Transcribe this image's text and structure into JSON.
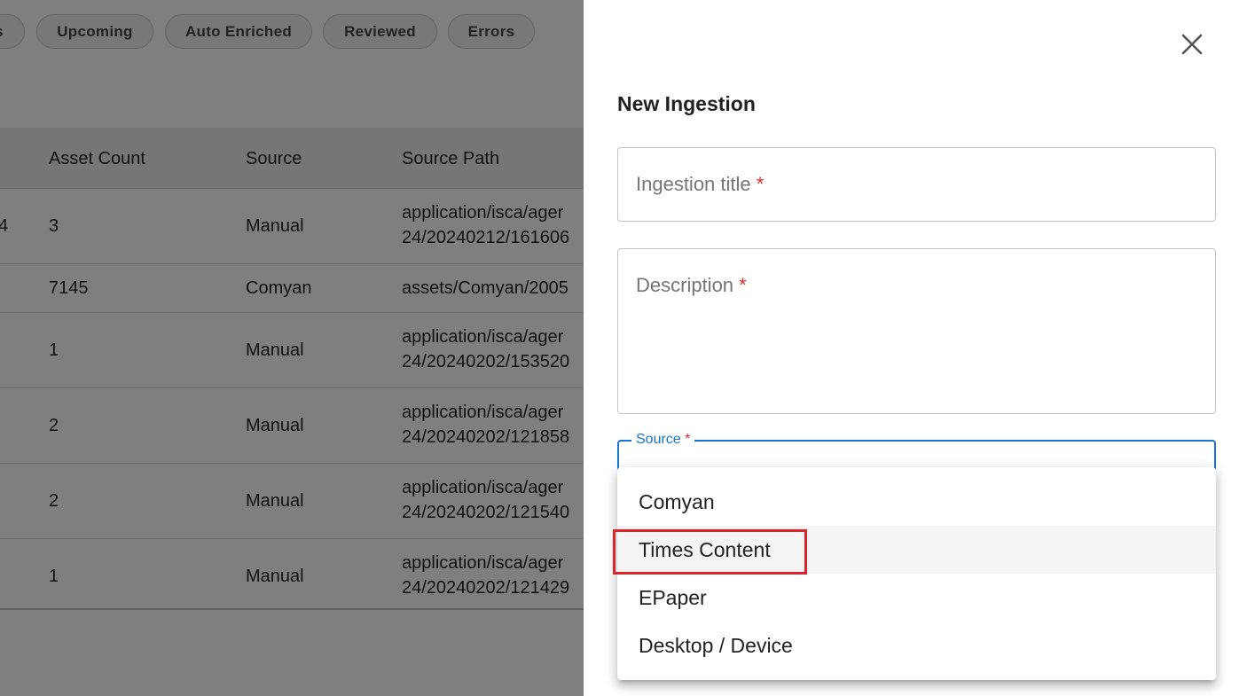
{
  "filter_chips": [
    "s",
    "Upcoming",
    "Auto Enriched",
    "Reviewed",
    "Errors"
  ],
  "table": {
    "columns": [
      "Asset Count",
      "Source",
      "Source Path"
    ],
    "rows": [
      {
        "lead": "4",
        "asset_count": "3",
        "source": "Manual",
        "path_line1": "application/isca/ager",
        "path_line2": "24/20240212/161606"
      },
      {
        "lead": "",
        "asset_count": "7145",
        "source": "Comyan",
        "path_line1": "assets/Comyan/2005",
        "path_line2": ""
      },
      {
        "lead": "",
        "asset_count": "1",
        "source": "Manual",
        "path_line1": "application/isca/ager",
        "path_line2": "24/20240202/153520"
      },
      {
        "lead": "",
        "asset_count": "2",
        "source": "Manual",
        "path_line1": "application/isca/ager",
        "path_line2": "24/20240202/121858"
      },
      {
        "lead": "",
        "asset_count": "2",
        "source": "Manual",
        "path_line1": "application/isca/ager",
        "path_line2": "24/20240202/121540"
      },
      {
        "lead": "",
        "asset_count": "1",
        "source": "Manual",
        "path_line1": "application/isca/ager",
        "path_line2": "24/20240202/121429"
      }
    ]
  },
  "drawer": {
    "title": "New Ingestion",
    "close_icon": "close-icon",
    "ingestion_title_label": "Ingestion title",
    "description_label": "Description",
    "source_label": "Source",
    "required_marker": "*",
    "source_options": [
      "Comyan",
      "Times Content",
      "EPaper",
      "Desktop / Device"
    ],
    "highlighted_option": "Times Content",
    "highlight_color": "#d6262c",
    "accent_color": "#1976d2"
  }
}
